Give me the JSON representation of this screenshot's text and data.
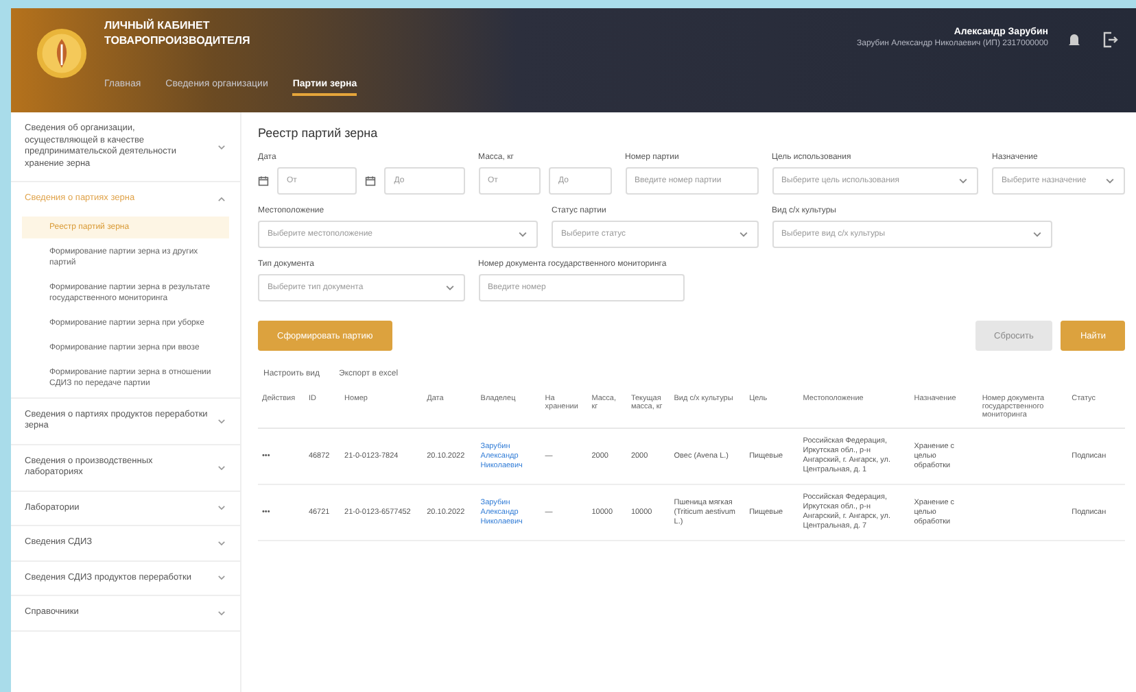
{
  "header": {
    "title_line_1": "ЛИЧНЫЙ КАБИНЕТ",
    "title_line_2": "ТОВАРОПРОИЗВОДИТЕЛЯ",
    "nav": [
      {
        "label": "Главная",
        "selected": false
      },
      {
        "label": "Сведения организации",
        "selected": false
      },
      {
        "label": "Партии зерна",
        "selected": true
      }
    ],
    "user_name": "Александр Зарубин",
    "user_org": "Зарубин Александр Николаевич (ИП) 2317000000"
  },
  "sidebar": [
    {
      "label": "Сведения об организации, осуществляющей в качестве предпринимательской деятельности хранение зерна",
      "expanded": false
    },
    {
      "label": "Сведения о партиях зерна",
      "expanded": true,
      "children": [
        {
          "label": "Реестр партий зерна",
          "selected": true
        },
        {
          "label": "Формирование партии зерна из других партий",
          "selected": false
        },
        {
          "label": "Формирование партии зерна в результате государственного мониторинга",
          "selected": false
        },
        {
          "label": "Формирование партии зерна при уборке",
          "selected": false
        },
        {
          "label": "Формирование партии зерна при ввозе",
          "selected": false
        },
        {
          "label": "Формирование партии зерна в отношении СДИЗ по передаче партии",
          "selected": false
        }
      ]
    },
    {
      "label": "Сведения о партиях продуктов переработки зерна",
      "expanded": false
    },
    {
      "label": "Сведения о производственных лабораториях",
      "expanded": false
    },
    {
      "label": "Лаборатории",
      "expanded": false
    },
    {
      "label": "Сведения СДИЗ",
      "expanded": false
    },
    {
      "label": "Сведения СДИЗ продуктов переработки",
      "expanded": false
    },
    {
      "label": "Справочники",
      "expanded": false
    }
  ],
  "page_title": "Реестр партий зерна",
  "filters": [
    {
      "kind": "daterange",
      "label": "Дата",
      "from": "От",
      "to": "До"
    },
    {
      "kind": "range",
      "label": "Масса, кг",
      "from": "От",
      "to": "До"
    },
    {
      "kind": "input",
      "label": "Номер партии",
      "placeholder": "Введите номер партии"
    },
    {
      "kind": "select",
      "label": "Цель использования",
      "placeholder": "Выберите цель использования"
    },
    {
      "kind": "select",
      "label": "Назначение",
      "placeholder": "Выберите назначение"
    },
    {
      "kind": "select",
      "label": "Местоположение",
      "placeholder": "Выберите местоположение"
    },
    {
      "kind": "select",
      "label": "Статус партии",
      "placeholder": "Выберите статус"
    },
    {
      "kind": "select",
      "label": "Вид с/х культуры",
      "placeholder": "Выберите вид с/х культуры"
    },
    {
      "kind": "select",
      "label": "Тип документа",
      "placeholder": "Выберите тип документа"
    },
    {
      "kind": "input",
      "label": "Номер документа государственного мониторинга",
      "placeholder": "Введите номер"
    }
  ],
  "buttons": {
    "create": "Сформировать партию",
    "reset": "Сбросить",
    "search": "Найти"
  },
  "table_tools": [
    "Настроить вид",
    "Экспорт в excel"
  ],
  "table": {
    "columns": [
      "Действия",
      "ID",
      "Номер",
      "Дата",
      "Владелец",
      "На хранении",
      "Масса, кг",
      "Текущая масса, кг",
      "Вид с/х культуры",
      "Цель",
      "Местоположение",
      "Назначение",
      "Номер документа государственного мониторинга",
      "Статус"
    ],
    "rows": [
      [
        "•••",
        "46872",
        "21-0-0123-7824",
        "20.10.2022",
        "Зарубин Александр Николаевич",
        "—",
        "2000",
        "2000",
        "Овес (Avena L.)",
        "Пищевые",
        "Российская Федерация, Иркутская обл., р-н Ангарский, г. Ангарск, ул. Центральная, д. 1",
        "Хранение с целью обработки",
        "",
        "Подписан"
      ],
      [
        "•••",
        "46721",
        "21-0-0123-6577452",
        "20.10.2022",
        "Зарубин Александр Николаевич",
        "—",
        "10000",
        "10000",
        "Пшеница мягкая (Triticum aestivum L.)",
        "Пищевые",
        "Российская Федерация, Иркутская обл., р-н Ангарский, г. Ангарск, ул. Центральная, д. 7",
        "Хранение с целью обработки",
        "",
        "Подписан"
      ]
    ]
  }
}
